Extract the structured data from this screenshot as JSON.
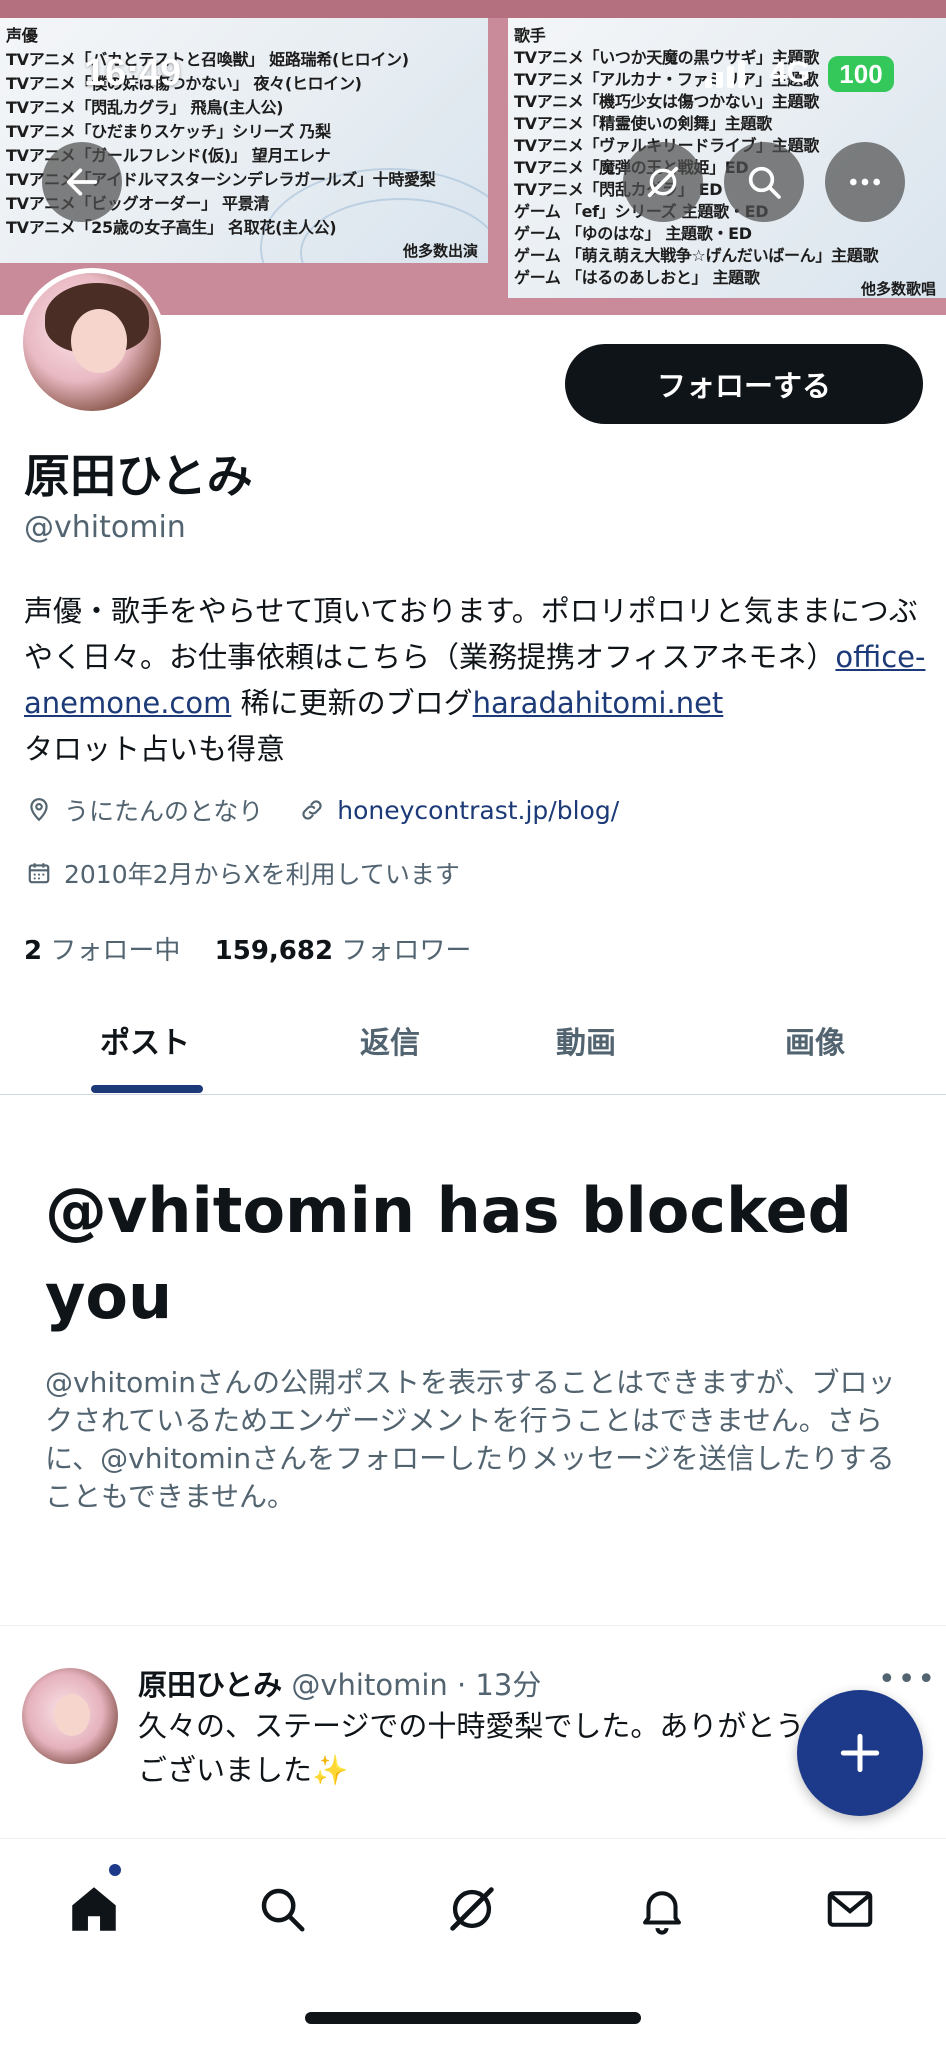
{
  "status_bar": {
    "time": "16:49",
    "network": "4G",
    "battery": "100"
  },
  "banner": {
    "left_heading": "声優",
    "left_lines": [
      "TVアニメ「バカとテストと召喚獣」 姫路瑞希(ヒロイン)",
      "TVアニメ「僕の妹は傷つかない」 夜々(ヒロイン)",
      "TVアニメ「閃乱カグラ」 飛鳥(主人公)",
      "TVアニメ「ひだまりスケッチ」シリーズ 乃梨",
      "TVアニメ「ガールフレンド(仮)」 望月エレナ",
      "TVアニメ「アイドルマスターシンデレラガールズ」十時愛梨",
      "TVアニメ「ビッグオーダー」 平景清",
      "TVアニメ「25歳の女子高生」 名取花(主人公)"
    ],
    "left_footer": "他多数出演",
    "right_heading": "歌手",
    "right_lines": [
      "TVアニメ「いつか天魔の黒ウサギ」主題歌",
      "TVアニメ「アルカナ・ファミリア」主題歌",
      "TVアニメ「機巧少女は傷つかない」主題歌",
      "TVアニメ「精霊使いの剣舞」主題歌",
      "TVアニメ「ヴァルキリードライブ」主題歌",
      "TVアニメ「魔弾の王と戦姫」ED",
      "TVアニメ「閃乱カグラ」 ED",
      "ゲーム 「ef」シリーズ 主題歌・ED",
      "ゲーム 「ゆのはな」 主題歌・ED",
      "ゲーム 「萌え萌え大戦争☆げんだいばーん」主題歌",
      "ゲーム 「はるのあしおと」 主題歌"
    ],
    "right_footer": "他多数歌唱"
  },
  "profile": {
    "display_name": "原田ひとみ",
    "handle": "@vhitomin",
    "follow_button": "フォローする",
    "bio_part1": "声優・歌手をやらせて頂いております。ポロリポロリと気ままにつぶやく日々。お仕事依頼はこちら（業務提携オフィスアネモネ）",
    "bio_link1": "office-anemone.com",
    "bio_part2": " 稀に更新のブログ",
    "bio_link2": "haradahitomi.net",
    "bio_part3": "タロット占いも得意",
    "location": "うにたんのとなり",
    "website": "honeycontrast.jp/blog/",
    "joined": "2010年2月からXを利用しています",
    "following_count": "2",
    "following_label": "フォロー中",
    "followers_count": "159,682",
    "followers_label": "フォロワー"
  },
  "tabs": [
    {
      "label": "ポスト",
      "active": true
    },
    {
      "label": "返信",
      "active": false
    },
    {
      "label": "動画",
      "active": false
    },
    {
      "label": "画像",
      "active": false
    }
  ],
  "blocked": {
    "title": "@vhitomin has blocked you",
    "description": "@vhitominさんの公開ポストを表示することはできますが、ブロックされているためエンゲージメントを行うことはできません。さらに、@vhitominさんをフォローしたりメッセージを送信したりすることもできません。"
  },
  "post": {
    "author": "原田ひとみ",
    "handle": "@vhitomin",
    "time": "13分",
    "separator": "·",
    "more": "•••",
    "text": "久々の、ステージでの十時愛梨でした。ありがとうございました✨"
  },
  "colors": {
    "accent": "#1d3a8a",
    "link": "#1d3a78",
    "banner_pink": "#c98a99",
    "battery_green": "#34c759"
  },
  "icons": {
    "back": "arrow-left-icon",
    "grok": "grok-icon",
    "search": "search-icon",
    "more": "more-horizontal-icon",
    "location": "location-pin-icon",
    "link": "link-icon",
    "calendar": "calendar-icon",
    "compose": "plus-icon",
    "nav": [
      "home-icon",
      "search-icon",
      "grok-icon",
      "bell-icon",
      "mail-icon"
    ]
  }
}
